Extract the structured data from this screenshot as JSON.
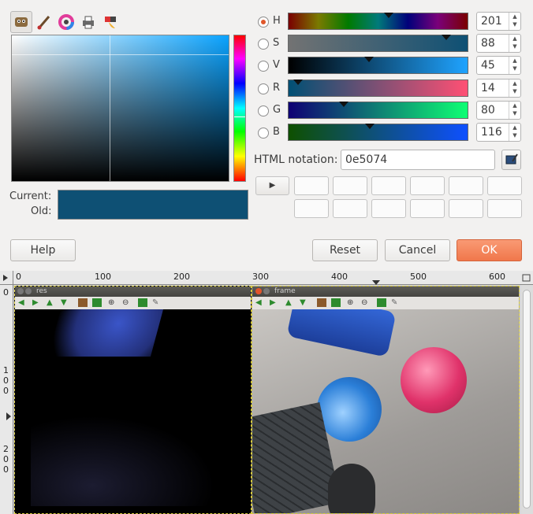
{
  "dialog": {
    "hsv_labels": {
      "h": "H",
      "s": "S",
      "v": "V",
      "r": "R",
      "g": "G",
      "b": "B"
    },
    "values": {
      "h": "201",
      "s": "88",
      "v": "45",
      "r": "14",
      "g": "80",
      "b": "116"
    },
    "html_notation_label": "HTML notation:",
    "html_notation_value": "0e5074",
    "current_label": "Current:",
    "old_label": "Old:",
    "current_color": "#0e5074",
    "old_color": "#0e5074",
    "buttons": {
      "help": "Help",
      "reset": "Reset",
      "cancel": "Cancel",
      "ok": "OK"
    },
    "slider_levels": {
      "h": 0.56,
      "s": 0.88,
      "v": 0.45,
      "r": 0.055,
      "g": 0.31,
      "b": 0.455
    }
  },
  "ruler": {
    "ticks": [
      "0",
      "100",
      "200",
      "300",
      "400",
      "500",
      "600"
    ],
    "vticks_1": [
      "1",
      "0",
      "0"
    ],
    "vticks_2": [
      "2",
      "0",
      "0"
    ],
    "vtick_0": "0"
  },
  "windows": {
    "res_title": "res",
    "frame_title": "frame"
  },
  "icons": {
    "picker": "color-picker-icon",
    "paintbrush": "paintbrush-icon",
    "wheel": "color-wheel-icon",
    "printer": "printer-icon",
    "watercolor": "watercolor-icon"
  }
}
